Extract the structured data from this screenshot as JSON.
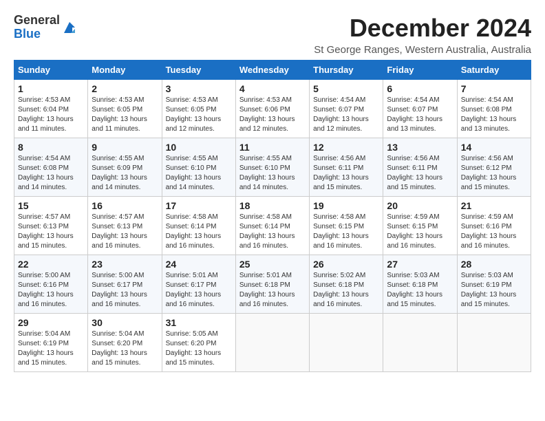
{
  "logo": {
    "text_general": "General",
    "text_blue": "Blue"
  },
  "title": "December 2024",
  "location": "St George Ranges, Western Australia, Australia",
  "days_of_week": [
    "Sunday",
    "Monday",
    "Tuesday",
    "Wednesday",
    "Thursday",
    "Friday",
    "Saturday"
  ],
  "weeks": [
    [
      {
        "day": "1",
        "sunrise": "4:53 AM",
        "sunset": "6:04 PM",
        "daylight": "13 hours and 11 minutes."
      },
      {
        "day": "2",
        "sunrise": "4:53 AM",
        "sunset": "6:05 PM",
        "daylight": "13 hours and 11 minutes."
      },
      {
        "day": "3",
        "sunrise": "4:53 AM",
        "sunset": "6:05 PM",
        "daylight": "13 hours and 12 minutes."
      },
      {
        "day": "4",
        "sunrise": "4:53 AM",
        "sunset": "6:06 PM",
        "daylight": "13 hours and 12 minutes."
      },
      {
        "day": "5",
        "sunrise": "4:54 AM",
        "sunset": "6:07 PM",
        "daylight": "13 hours and 12 minutes."
      },
      {
        "day": "6",
        "sunrise": "4:54 AM",
        "sunset": "6:07 PM",
        "daylight": "13 hours and 13 minutes."
      },
      {
        "day": "7",
        "sunrise": "4:54 AM",
        "sunset": "6:08 PM",
        "daylight": "13 hours and 13 minutes."
      }
    ],
    [
      {
        "day": "8",
        "sunrise": "4:54 AM",
        "sunset": "6:08 PM",
        "daylight": "13 hours and 14 minutes."
      },
      {
        "day": "9",
        "sunrise": "4:55 AM",
        "sunset": "6:09 PM",
        "daylight": "13 hours and 14 minutes."
      },
      {
        "day": "10",
        "sunrise": "4:55 AM",
        "sunset": "6:10 PM",
        "daylight": "13 hours and 14 minutes."
      },
      {
        "day": "11",
        "sunrise": "4:55 AM",
        "sunset": "6:10 PM",
        "daylight": "13 hours and 14 minutes."
      },
      {
        "day": "12",
        "sunrise": "4:56 AM",
        "sunset": "6:11 PM",
        "daylight": "13 hours and 15 minutes."
      },
      {
        "day": "13",
        "sunrise": "4:56 AM",
        "sunset": "6:11 PM",
        "daylight": "13 hours and 15 minutes."
      },
      {
        "day": "14",
        "sunrise": "4:56 AM",
        "sunset": "6:12 PM",
        "daylight": "13 hours and 15 minutes."
      }
    ],
    [
      {
        "day": "15",
        "sunrise": "4:57 AM",
        "sunset": "6:13 PM",
        "daylight": "13 hours and 15 minutes."
      },
      {
        "day": "16",
        "sunrise": "4:57 AM",
        "sunset": "6:13 PM",
        "daylight": "13 hours and 16 minutes."
      },
      {
        "day": "17",
        "sunrise": "4:58 AM",
        "sunset": "6:14 PM",
        "daylight": "13 hours and 16 minutes."
      },
      {
        "day": "18",
        "sunrise": "4:58 AM",
        "sunset": "6:14 PM",
        "daylight": "13 hours and 16 minutes."
      },
      {
        "day": "19",
        "sunrise": "4:58 AM",
        "sunset": "6:15 PM",
        "daylight": "13 hours and 16 minutes."
      },
      {
        "day": "20",
        "sunrise": "4:59 AM",
        "sunset": "6:15 PM",
        "daylight": "13 hours and 16 minutes."
      },
      {
        "day": "21",
        "sunrise": "4:59 AM",
        "sunset": "6:16 PM",
        "daylight": "13 hours and 16 minutes."
      }
    ],
    [
      {
        "day": "22",
        "sunrise": "5:00 AM",
        "sunset": "6:16 PM",
        "daylight": "13 hours and 16 minutes."
      },
      {
        "day": "23",
        "sunrise": "5:00 AM",
        "sunset": "6:17 PM",
        "daylight": "13 hours and 16 minutes."
      },
      {
        "day": "24",
        "sunrise": "5:01 AM",
        "sunset": "6:17 PM",
        "daylight": "13 hours and 16 minutes."
      },
      {
        "day": "25",
        "sunrise": "5:01 AM",
        "sunset": "6:18 PM",
        "daylight": "13 hours and 16 minutes."
      },
      {
        "day": "26",
        "sunrise": "5:02 AM",
        "sunset": "6:18 PM",
        "daylight": "13 hours and 16 minutes."
      },
      {
        "day": "27",
        "sunrise": "5:03 AM",
        "sunset": "6:18 PM",
        "daylight": "13 hours and 15 minutes."
      },
      {
        "day": "28",
        "sunrise": "5:03 AM",
        "sunset": "6:19 PM",
        "daylight": "13 hours and 15 minutes."
      }
    ],
    [
      {
        "day": "29",
        "sunrise": "5:04 AM",
        "sunset": "6:19 PM",
        "daylight": "13 hours and 15 minutes."
      },
      {
        "day": "30",
        "sunrise": "5:04 AM",
        "sunset": "6:20 PM",
        "daylight": "13 hours and 15 minutes."
      },
      {
        "day": "31",
        "sunrise": "5:05 AM",
        "sunset": "6:20 PM",
        "daylight": "13 hours and 15 minutes."
      },
      null,
      null,
      null,
      null
    ]
  ]
}
